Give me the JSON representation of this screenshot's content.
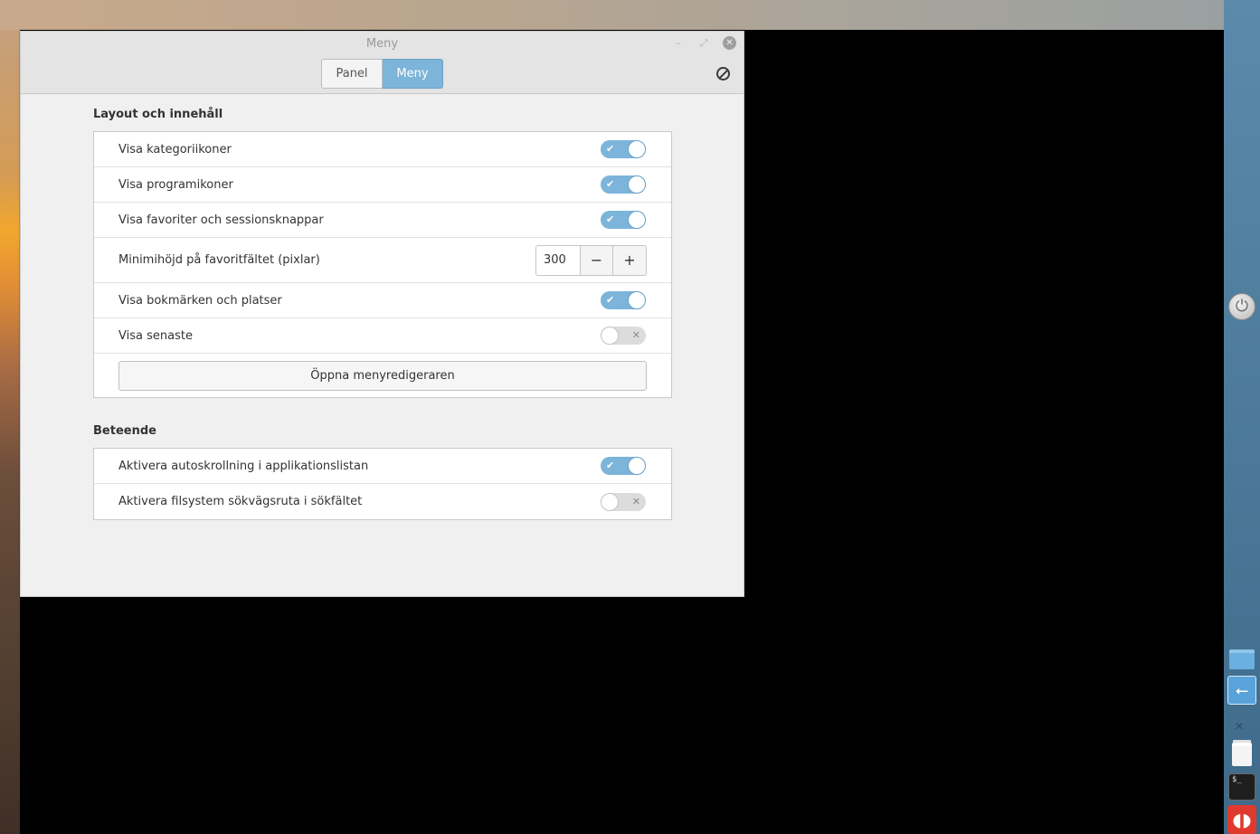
{
  "window": {
    "title": "Meny",
    "tabs": [
      {
        "label": "Panel",
        "active": false
      },
      {
        "label": "Meny",
        "active": true
      }
    ]
  },
  "sections": [
    {
      "title": "Layout och innehåll",
      "rows": [
        {
          "label": "Visa kategoriikoner",
          "type": "switch",
          "on": true
        },
        {
          "label": "Visa programikoner",
          "type": "switch",
          "on": true
        },
        {
          "label": "Visa favoriter och sessionsknappar",
          "type": "switch",
          "on": true
        },
        {
          "label": "Minimihöjd på favoritfältet (pixlar)",
          "type": "spin",
          "value": "300"
        },
        {
          "label": "Visa bokmärken och platser",
          "type": "switch",
          "on": true
        },
        {
          "label": "Visa senaste",
          "type": "switch",
          "on": false
        },
        {
          "label": "Öppna menyredigeraren",
          "type": "button"
        }
      ]
    },
    {
      "title": "Beteende",
      "rows": [
        {
          "label": "Aktivera autoskrollning i applikationslistan",
          "type": "switch",
          "on": true
        },
        {
          "label": "Aktivera filsystem sökvägsruta i sökfältet",
          "type": "switch",
          "on": false
        }
      ]
    }
  ],
  "colors": {
    "accent": "#7cb4da",
    "window_bg": "#f0f0f0",
    "titlebar_bg": "#e4e4e4"
  },
  "icons": {
    "reset": "reset-icon",
    "power": "power-icon",
    "folder": "folder-icon",
    "usb": "usb-icon",
    "trash": "trash-icon",
    "terminal": "terminal-icon"
  }
}
